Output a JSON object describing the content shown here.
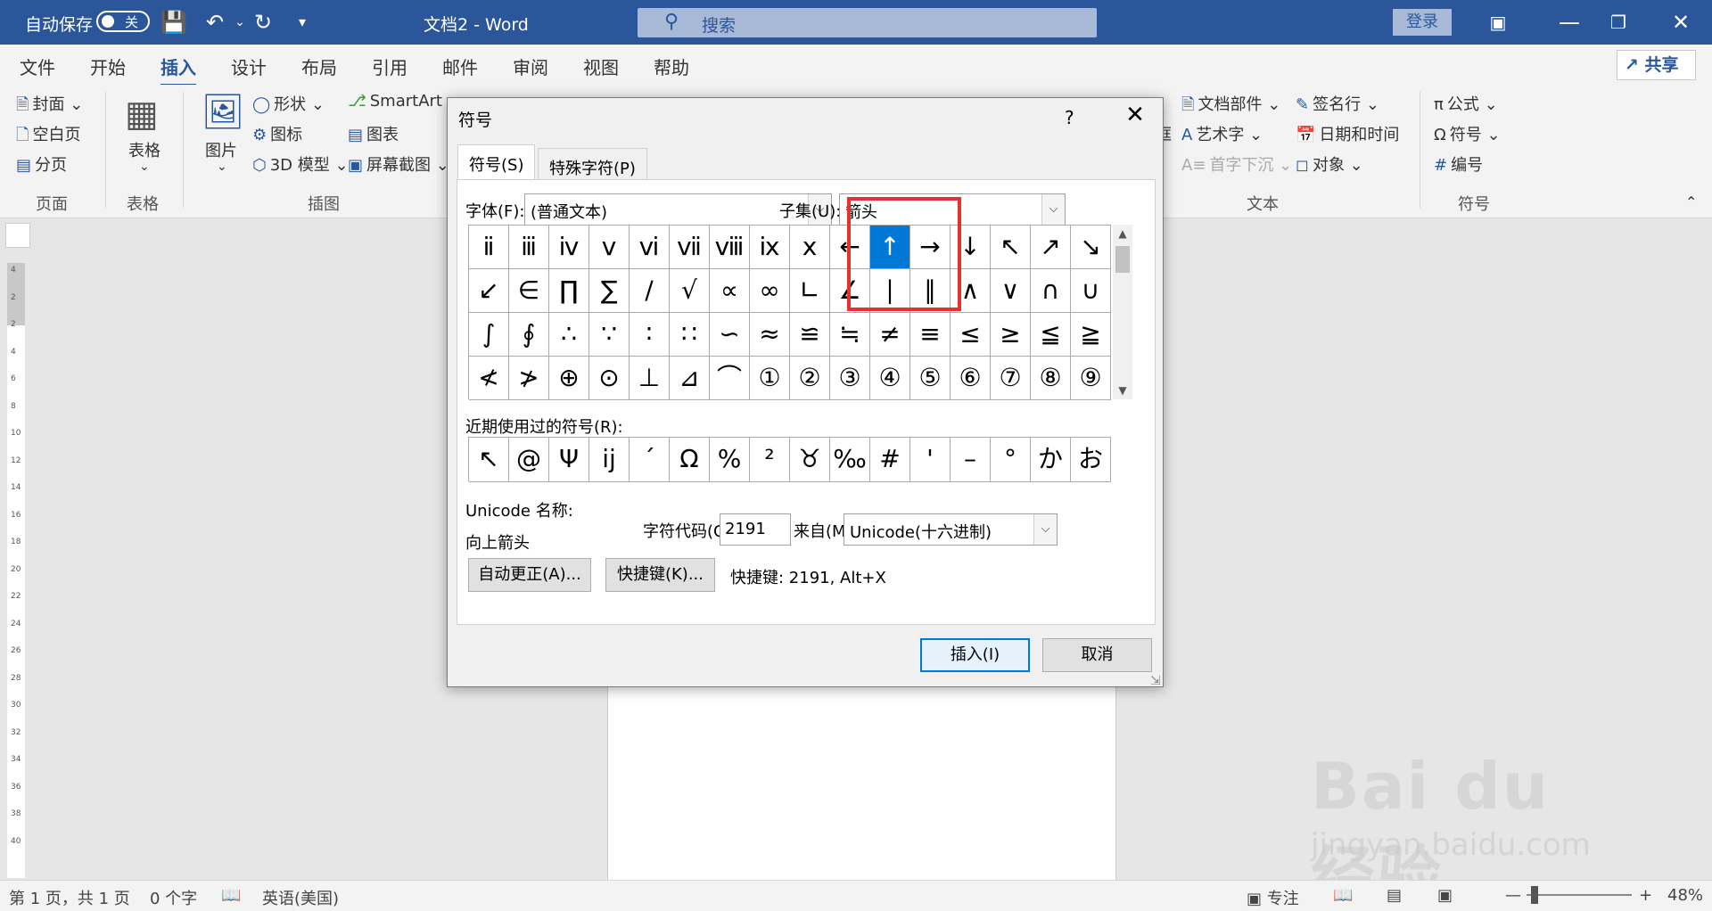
{
  "titlebar": {
    "autosave_label": "自动保存",
    "autosave_state": "关",
    "doc_title": "文档2 - Word",
    "search_placeholder": "搜索",
    "login_label": "登录"
  },
  "tabs": [
    "文件",
    "开始",
    "插入",
    "设计",
    "布局",
    "引用",
    "邮件",
    "审阅",
    "视图",
    "帮助"
  ],
  "active_tab": "插入",
  "share_label": "共享",
  "ribbon": {
    "pages": {
      "cover": "封面",
      "blank": "空白页",
      "break": "分页",
      "group": "页面"
    },
    "tables": {
      "table": "表格",
      "group": "表格"
    },
    "illustrations": {
      "pictures": "图片",
      "shapes": "形状",
      "icons": "图标",
      "model3d": "3D 模型",
      "smartart": "SmartArt",
      "chart": "图表",
      "screenshot": "屏幕截图",
      "group": "插图"
    },
    "text": {
      "quickparts": "文档部件",
      "wordart": "艺术字",
      "dropcap": "首字下沉",
      "signature": "签名行",
      "datetime": "日期和时间",
      "object": "对象",
      "group": "文本",
      "textbox_partial": "框"
    },
    "symbols": {
      "equation": "公式",
      "symbol": "符号",
      "number": "编号",
      "group": "符号"
    }
  },
  "ruler_numbers": [
    "4",
    "2",
    "2",
    "4",
    "6",
    "8",
    "10",
    "12",
    "14",
    "16",
    "18",
    "20",
    "22",
    "24",
    "26",
    "28",
    "30",
    "32",
    "34",
    "36",
    "38",
    "40"
  ],
  "dialog": {
    "title": "符号",
    "help": "?",
    "tabs": [
      "符号(S)",
      "特殊字符(P)"
    ],
    "font_label": "字体(F):",
    "font_value": "(普通文本)",
    "subset_label": "子集(U):",
    "subset_value": "箭头",
    "grid": [
      [
        "ⅱ",
        "ⅲ",
        "ⅳ",
        "ⅴ",
        "ⅵ",
        "ⅶ",
        "ⅷ",
        "ⅸ",
        "ⅹ",
        "←",
        "↑",
        "→",
        "↓",
        "↖",
        "↗",
        "↘"
      ],
      [
        "↙",
        "∈",
        "∏",
        "∑",
        "∕",
        "√",
        "∝",
        "∞",
        "∟",
        "∠",
        "∣",
        "∥",
        "∧",
        "∨",
        "∩",
        "∪"
      ],
      [
        "∫",
        "∮",
        "∴",
        "∵",
        "∶",
        "∷",
        "∽",
        "≈",
        "≌",
        "≒",
        "≠",
        "≡",
        "≤",
        "≥",
        "≦",
        "≧"
      ],
      [
        "≮",
        "≯",
        "⊕",
        "⊙",
        "⊥",
        "⊿",
        "⌒",
        "①",
        "②",
        "③",
        "④",
        "⑤",
        "⑥",
        "⑦",
        "⑧",
        "⑨"
      ]
    ],
    "selected": {
      "row": 0,
      "col": 10
    },
    "recent_label": "近期使用过的符号(R):",
    "recent": [
      "↖",
      "@",
      "Ψ",
      "ĳ",
      "´",
      "Ω",
      "%",
      "²",
      "♉",
      "‰",
      "#",
      "'",
      "–",
      "°",
      "か",
      "お"
    ],
    "unicode_name_label": "Unicode 名称:",
    "unicode_name_value": "向上箭头",
    "char_code_label": "字符代码(C):",
    "char_code_value": "2191",
    "from_label": "来自(M):",
    "from_value": "Unicode(十六进制)",
    "autocorrect_btn": "自动更正(A)...",
    "shortcut_btn": "快捷键(K)...",
    "shortcut_text": "快捷键: 2191, Alt+X",
    "insert_btn": "插入(I)",
    "cancel_btn": "取消"
  },
  "statusbar": {
    "page": "第 1 页，共 1 页",
    "words": "0 个字",
    "language": "英语(美国)",
    "focus": "专注",
    "zoom": "48%"
  },
  "watermark": {
    "brand": "Bai du 经验",
    "url": "jingyan.baidu.com"
  },
  "colors": {
    "accent": "#2b579a",
    "selection": "#0078d7",
    "highlight_box": "#e8302f"
  }
}
